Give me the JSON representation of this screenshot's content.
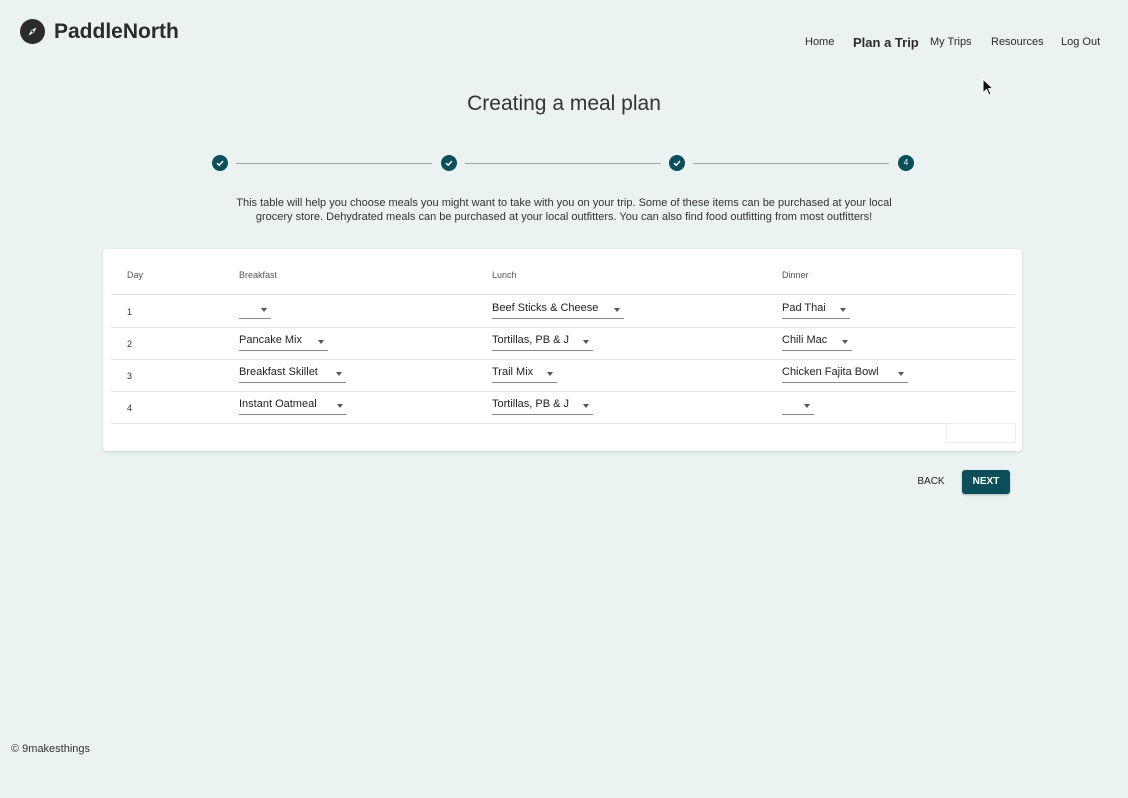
{
  "header": {
    "brand": "PaddleNorth",
    "logo_icon": "compass-icon",
    "nav": [
      {
        "label": "Home"
      },
      {
        "label": "Plan a Trip",
        "active": true
      },
      {
        "label": "My Trips"
      },
      {
        "label": "Resources"
      },
      {
        "label": "Log Out"
      }
    ]
  },
  "page": {
    "title": "Creating a meal plan",
    "stepper": {
      "current_step_label": "4",
      "completed_icon": "check-icon",
      "steps": [
        "completed",
        "completed",
        "completed",
        "active"
      ]
    },
    "intro": "This table will help you choose meals you might want to take with you on your trip. Some of these items can be purchased at your local grocery store. Dehydrated meals can be purchased at your local outfitters. You can also find food outfitting from most outfitters!"
  },
  "table": {
    "headers": [
      "Day",
      "Breakfast",
      "Lunch",
      "Dinner"
    ],
    "rows": [
      {
        "day": "1",
        "breakfast": "",
        "lunch": "Beef Sticks & Cheese",
        "dinner": "Pad Thai"
      },
      {
        "day": "2",
        "breakfast": "Pancake Mix",
        "lunch": "Tortillas, PB & J",
        "dinner": "Chili Mac"
      },
      {
        "day": "3",
        "breakfast": "Breakfast Skillet",
        "lunch": "Trail Mix",
        "dinner": "Chicken Fajita Bowl"
      },
      {
        "day": "4",
        "breakfast": "Instant Oatmeal",
        "lunch": "Tortillas, PB & J",
        "dinner": ""
      }
    ]
  },
  "actions": {
    "back_label": "BACK",
    "next_label": "NEXT"
  },
  "footer": {
    "text": "© 9makesthings"
  },
  "colors": {
    "background": "#eaf3f1",
    "primary": "#0c4f5a",
    "card": "#ffffff"
  }
}
